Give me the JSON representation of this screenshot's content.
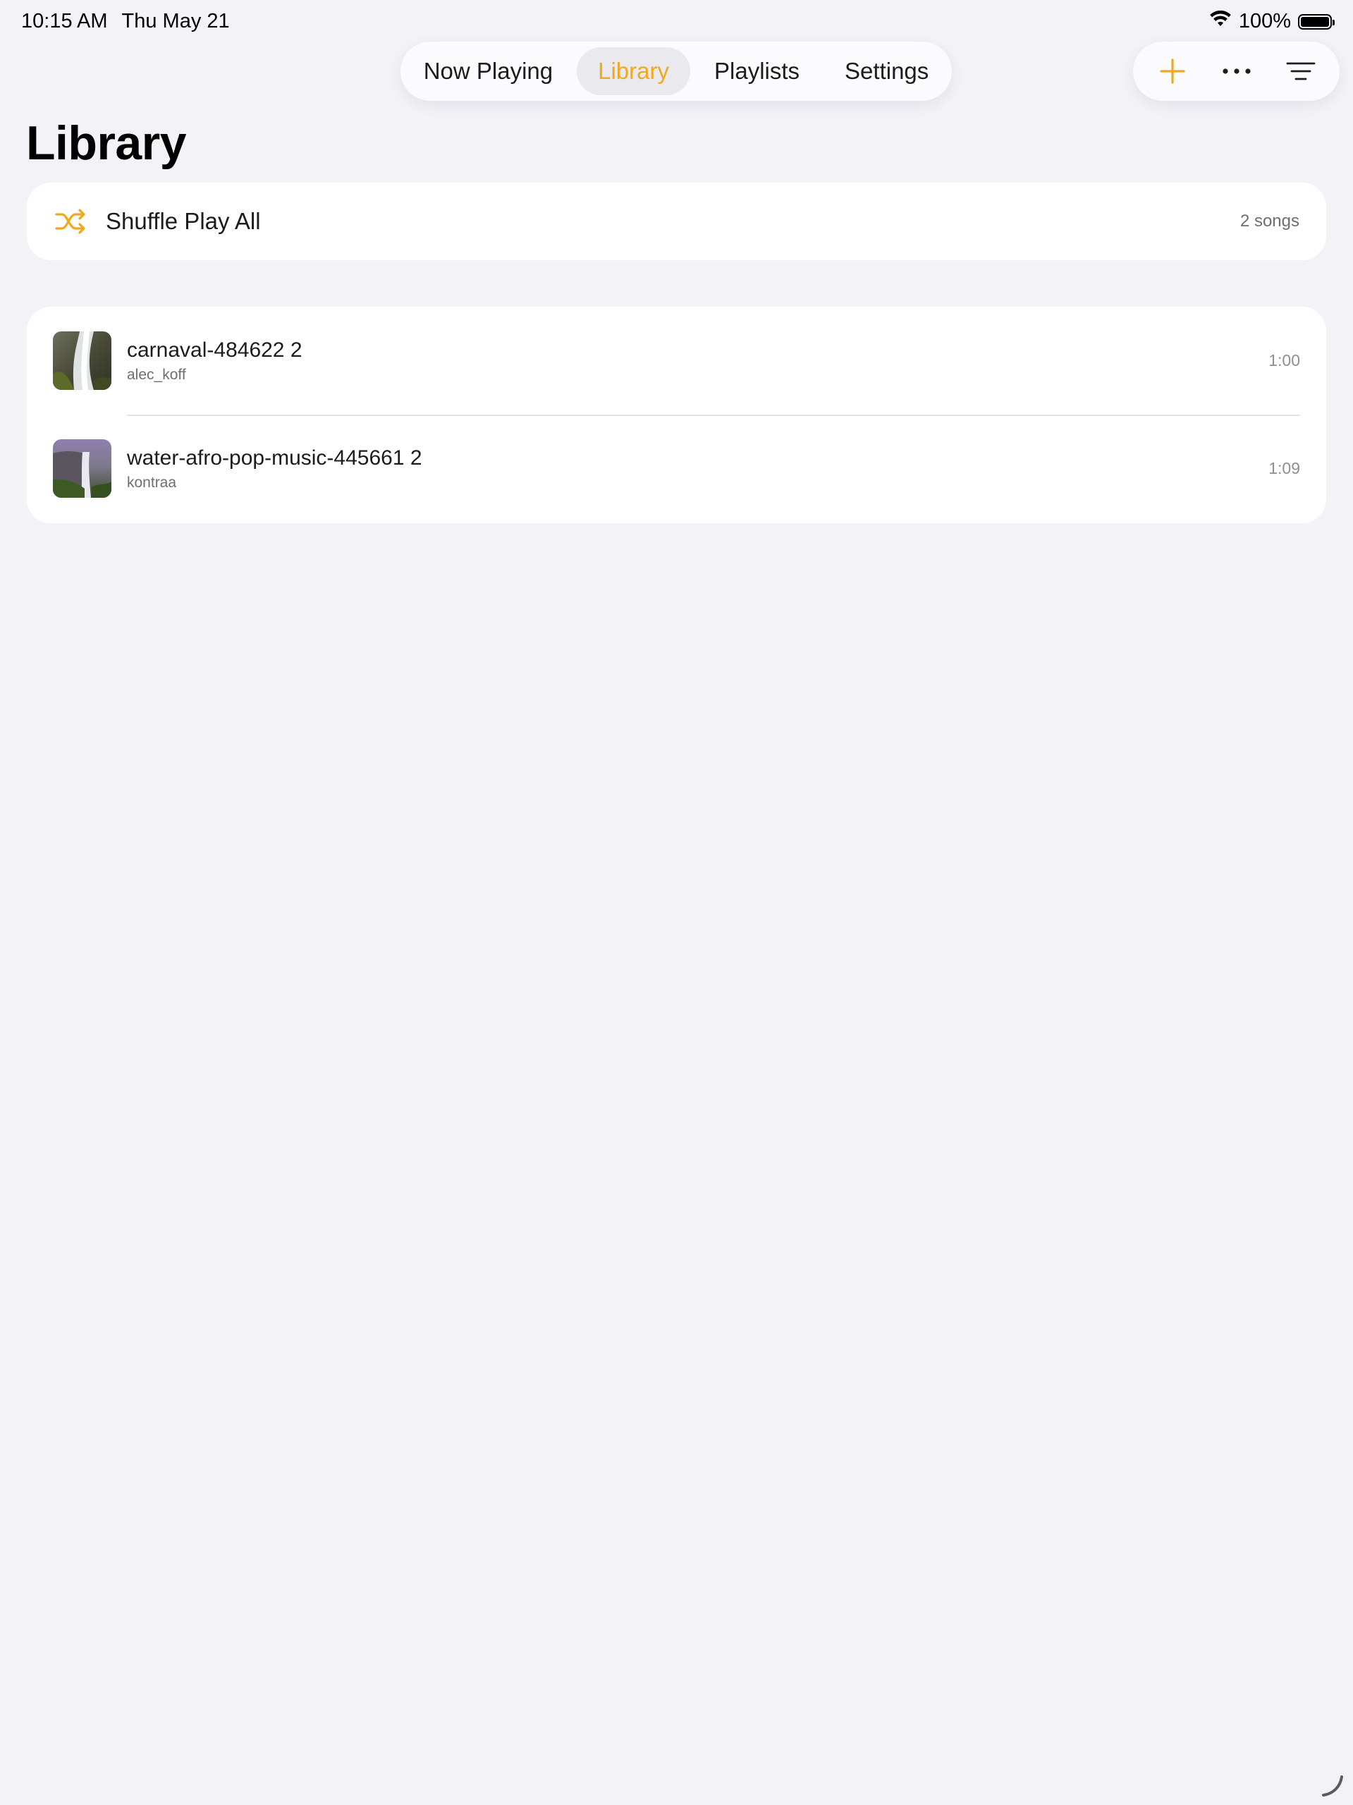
{
  "status_bar": {
    "time": "10:15 AM",
    "date": "Thu May 21",
    "battery": "100%",
    "battery_level": 1.0
  },
  "tabs": [
    {
      "label": "Now Playing",
      "active": false
    },
    {
      "label": "Library",
      "active": true
    },
    {
      "label": "Playlists",
      "active": false
    },
    {
      "label": "Settings",
      "active": false
    }
  ],
  "actions": {
    "add": "plus-icon",
    "more": "ellipsis-icon",
    "sort": "sort-lines-icon"
  },
  "page": {
    "title": "Library"
  },
  "shuffle": {
    "label": "Shuffle Play All",
    "count": "2 songs",
    "icon": "shuffle-icon"
  },
  "songs": [
    {
      "title": "carnaval-484622 2",
      "artist": "alec_koff",
      "duration": "1:00"
    },
    {
      "title": "water-afro-pop-music-445661 2",
      "artist": "kontraa",
      "duration": "1:09"
    }
  ],
  "colors": {
    "accent": "#EEA91F",
    "background": "#F2F2F7",
    "card": "#FFFFFF",
    "secondary_text": "#6E6E73"
  }
}
